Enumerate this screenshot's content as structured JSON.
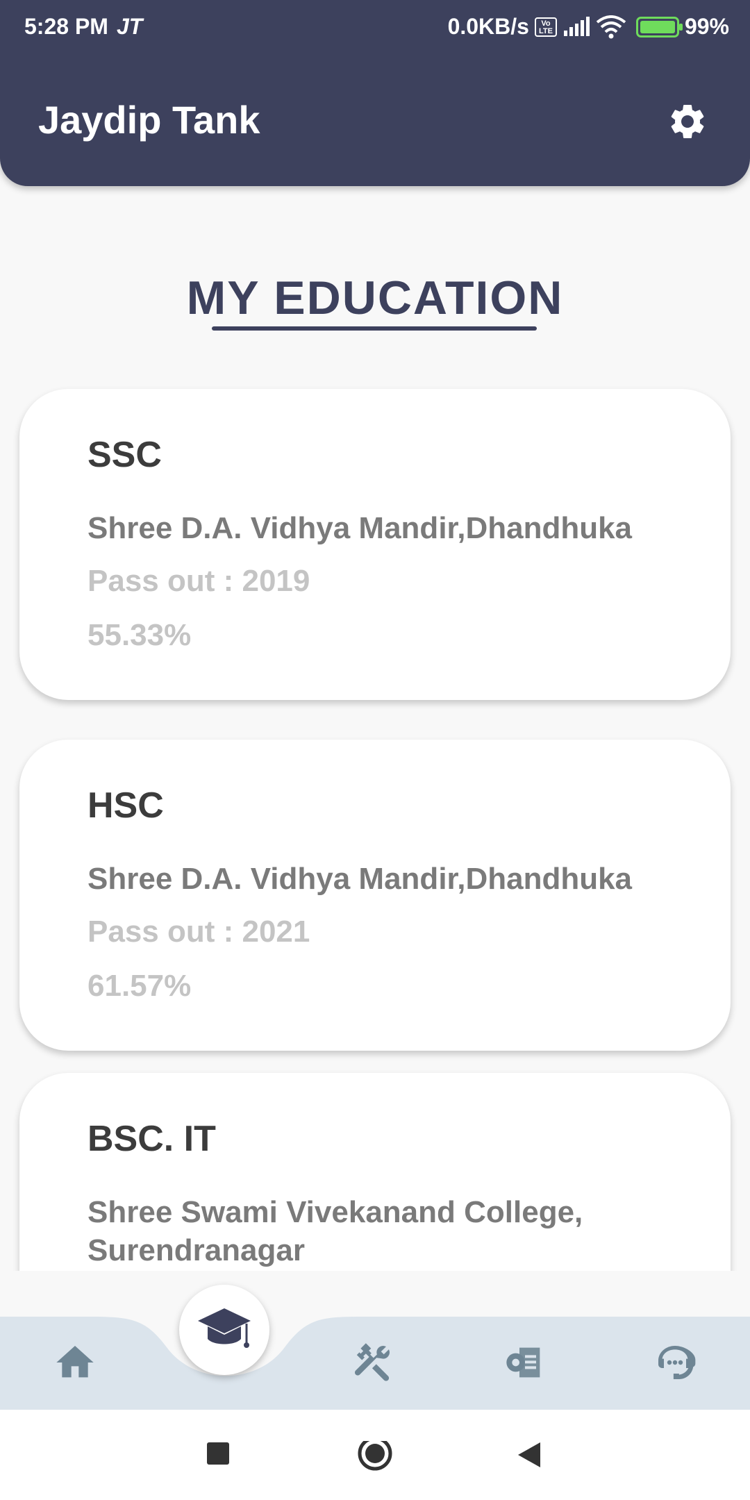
{
  "status_bar": {
    "time": "5:28 PM",
    "carrier": "JT",
    "network_speed": "0.0KB/s",
    "volte_label": "Vo LTE",
    "battery": "99%"
  },
  "header": {
    "title": "Jaydip Tank",
    "settings_icon": "gear-icon"
  },
  "section": {
    "title": "MY EDUCATION"
  },
  "education": [
    {
      "degree": "SSC",
      "school": "Shree D.A. Vidhya Mandir,Dhandhuka",
      "pass_out": "Pass out : 2019",
      "score": "55.33%"
    },
    {
      "degree": "HSC",
      "school": "Shree D.A. Vidhya Mandir,Dhandhuka",
      "pass_out": "Pass out : 2021",
      "score": "61.57%"
    },
    {
      "degree": "BSC. IT",
      "school": "Shree Swami Vivekanand College, Surendranagar",
      "pass_out": "",
      "score": ""
    }
  ],
  "bottom_nav": {
    "items": [
      {
        "icon": "home-icon",
        "active": false
      },
      {
        "icon": "graduation-cap-icon",
        "active": true
      },
      {
        "icon": "tools-icon",
        "active": false
      },
      {
        "icon": "projects-icon",
        "active": false
      },
      {
        "icon": "contact-support-icon",
        "active": false
      }
    ],
    "active_color": "#3d415d",
    "inactive_color": "#6e8594"
  },
  "colors": {
    "primary": "#3d415d",
    "background": "#f8f8f8",
    "nav_background": "#dbe4ec"
  }
}
